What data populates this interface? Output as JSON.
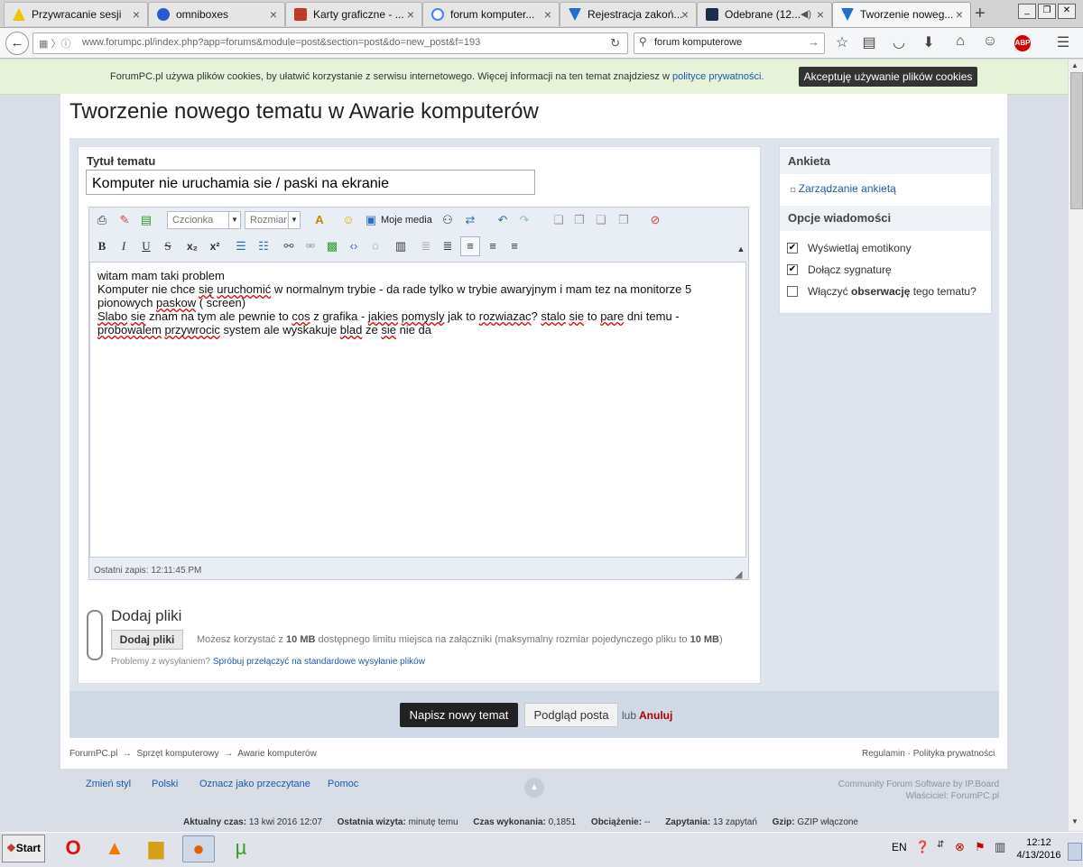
{
  "browser": {
    "tabs": [
      {
        "title": "Przywracanie sesji",
        "color": "#e8b400"
      },
      {
        "title": "omniboxes",
        "color": "#2a5bd7"
      },
      {
        "title": "Karty graficzne - ...",
        "color": "#c0392b"
      },
      {
        "title": "forum komputer...",
        "color": "#4285f4"
      },
      {
        "title": "Rejestracja zakoń...",
        "color": "#1f6fd1"
      },
      {
        "title": "Odebrane (12...",
        "color": "#1e2d4a"
      },
      {
        "title": "Tworzenie noweg...",
        "color": "#1f6fd1"
      }
    ],
    "url": "www.forumpc.pl/index.php?app=forums&module=post&section=post&do=new_post&f=193",
    "search_value": "forum komputerowe",
    "adblock_label": "ABP"
  },
  "cookie": {
    "text": "ForumPC.pl używa plików cookies, by ułatwić korzystanie z serwisu internetowego. Więcej informacji na ten temat znajdziesz w",
    "link": "polityce prywatności.",
    "accept": "Akceptuję używanie plików cookies"
  },
  "page": {
    "heading": "Tworzenie nowego tematu w Awarie komputerów",
    "title_label": "Tytuł tematu",
    "title_value": "Komputer nie uruchamia sie / paski na ekranie"
  },
  "editor": {
    "font_placeholder": "Czcionka",
    "size_placeholder": "Rozmiar",
    "media_label": "Moje media",
    "last_save": "Ostatni zapis: 12:11:45 PM",
    "body": {
      "line1": "witam mam taki problem",
      "line2a": "Komputer nie chce ",
      "line2b": "się",
      "line2c": " ",
      "line2d": "uruchomić",
      "line2e": " w normalnym trybie - da rade tylko w trybie awaryjnym i mam tez na monitorze 5 pionowych ",
      "line2f": "paskow",
      "line2g": " ( screen)",
      "line3a": "Slabo",
      "line3b": " ",
      "line3c": "sie",
      "line3d": " znam na tym ale pewnie to ",
      "line3e": "cos",
      "line3f": " z grafika - ",
      "line3g": "jakies",
      "line3h": " ",
      "line3i": "pomysly",
      "line3j": " jak to ",
      "line3k": "rozwiazac",
      "line3l": "? ",
      "line3m": "stalo",
      "line3n": " ",
      "line3o": "sie",
      "line3p": " to ",
      "line3q": "pare",
      "line3r": " dni temu - ",
      "line3s": "probowalem",
      "line3t": " ",
      "line3u": "przywrocic",
      "line3v": " system ale wyskakuje ",
      "line3w": "blad",
      "line3x": " ze ",
      "line3y": "sie",
      "line3z": " nie da"
    }
  },
  "attachments": {
    "title": "Dodaj pliki",
    "button": "Dodaj pliki",
    "info_prefix": "Możesz korzystać z ",
    "limit1": "10 MB",
    "info_mid": " dostępnego limitu miejsca na załączniki (maksymalny rozmiar pojedynczego pliku to ",
    "limit2": "10 MB",
    "info_suffix": ")",
    "problems_prefix": "Problemy z wysyłaniem?",
    "problems_link": "Spróbuj przełączyć na standardowe wysyłanie plików"
  },
  "sidebar": {
    "poll_heading": "Ankieta",
    "poll_manage": "Zarządzanie ankietą",
    "options_heading": "Opcje wiadomości",
    "options": [
      {
        "label": "Wyświetlaj emotikony",
        "checked": true
      },
      {
        "label": "Dołącz sygnaturę",
        "checked": true
      },
      {
        "label_prefix": "Włączyć ",
        "label_bold": "obserwację",
        "label_suffix": " tego tematu?",
        "checked": false
      }
    ]
  },
  "submit": {
    "post": "Napisz nowy temat",
    "preview": "Podgląd posta",
    "or": "lub",
    "cancel": "Anuluj"
  },
  "breadcrumbs": [
    "ForumPC.pl",
    "Sprzęt komputerowy",
    "Awarie komputerów"
  ],
  "footer": {
    "rules": "Regulamin",
    "privacy": "Polityka prywatności",
    "change_style": "Zmień styl",
    "language": "Polski",
    "mark_read": "Oznacz jako przeczytane",
    "help": "Pomoc",
    "software": "Community Forum Software by IP.Board",
    "owner": "Właściciel: ForumPC.pl",
    "stats": [
      {
        "label": "Aktualny czas:",
        "value": "13 kwi 2016 12:07"
      },
      {
        "label": "Ostatnia wizyta:",
        "value": "minutę temu"
      },
      {
        "label": "Czas wykonania:",
        "value": "0,1851"
      },
      {
        "label": "Obciążenie:",
        "value": "--"
      },
      {
        "label": "Zapytania:",
        "value": "13 zapytań"
      },
      {
        "label": "Gzip:",
        "value": "GZIP włączone"
      }
    ]
  },
  "taskbar": {
    "start": "Start",
    "lang": "EN",
    "time": "12:12",
    "date": "4/13/2016"
  }
}
